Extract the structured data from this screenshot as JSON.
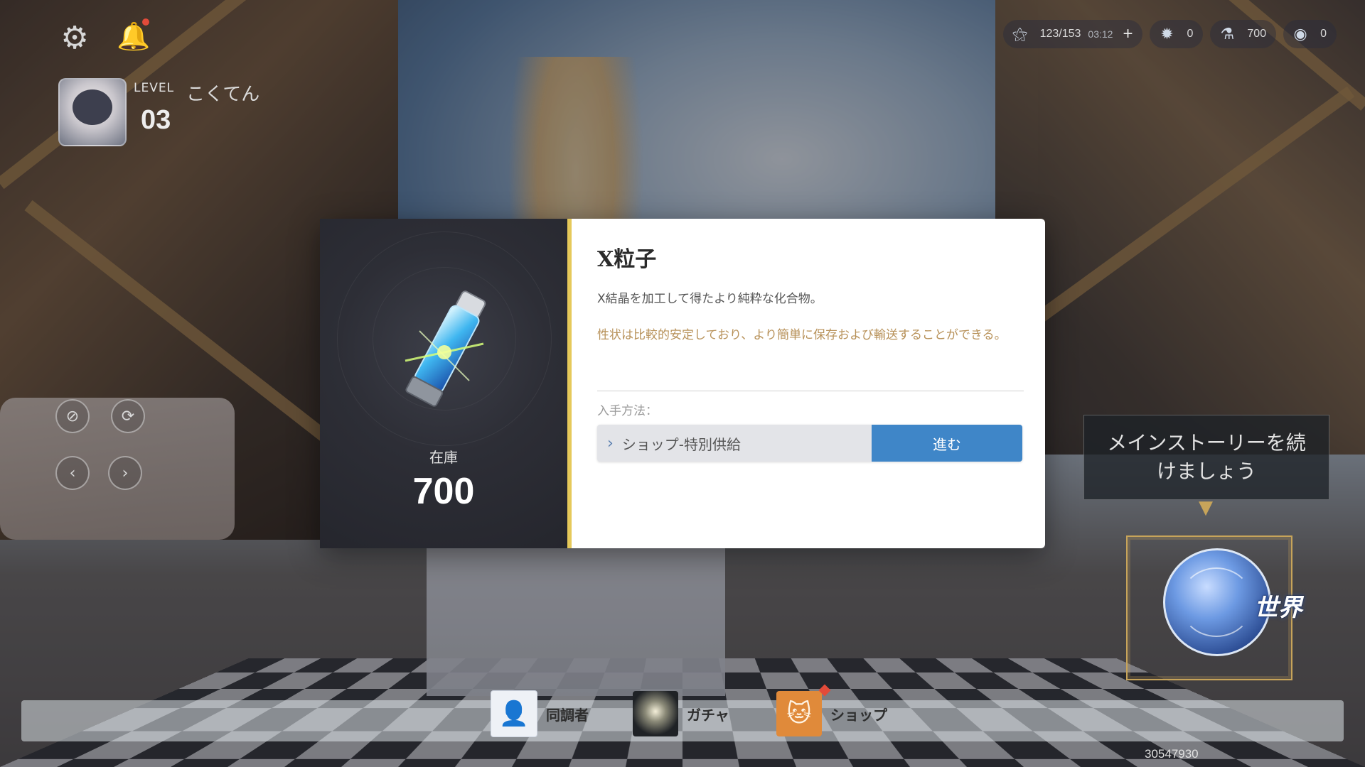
{
  "header": {
    "level_label": "LEVEL",
    "level": "03",
    "player_name": "こくてん"
  },
  "resources": {
    "stamina": "123/153",
    "stamina_timer": "03:12",
    "crystal": "0",
    "particle": "700",
    "coin": "0"
  },
  "dialog": {
    "stock_label": "在庫",
    "stock_value": "700",
    "title": "X粒子",
    "description": "X結晶を加工して得たより純粋な化合物。",
    "flavor": "性状は比較的安定しており、より簡単に保存および輸送することができる。",
    "acquire_label": "入手方法：",
    "acquire_source": "ショップ-特別供給",
    "go_button": "進む"
  },
  "story": {
    "tip": "メインストーリーを続けましょう",
    "world_label": "世界"
  },
  "bottom_nav": {
    "items": [
      {
        "label": "同調者",
        "icon": "person-icon"
      },
      {
        "label": "ガチャ",
        "icon": "gacha-orb-icon"
      },
      {
        "label": "ショップ",
        "icon": "shop-cat-icon"
      }
    ]
  },
  "footer": {
    "uid": "30547930"
  },
  "colors": {
    "accent_gold": "#e6c95a",
    "button_blue": "#3f86c8",
    "flavor_text": "#b8925a",
    "notify_red": "#e34b3a"
  }
}
